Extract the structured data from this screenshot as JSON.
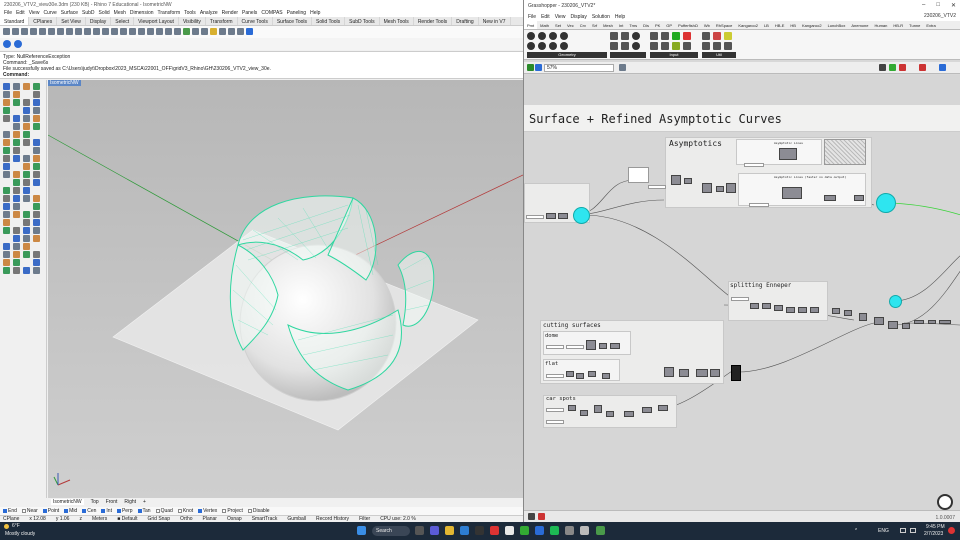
{
  "rhino": {
    "title": "230206_VTV2_view30e.3dm (230 KB) - Rhino 7 Educational - IsometricNW",
    "menu": [
      "File",
      "Edit",
      "View",
      "Curve",
      "Surface",
      "SubD",
      "Solid",
      "Mesh",
      "Dimension",
      "Transform",
      "Tools",
      "Analyze",
      "Render",
      "Panels",
      "COMPAS",
      "Paneling",
      "Help"
    ],
    "tabs": [
      "Standard",
      "CPlanes",
      "Set View",
      "Display",
      "Select",
      "Viewport Layout",
      "Visibility",
      "Transform",
      "Curve Tools",
      "Surface Tools",
      "Solid Tools",
      "SubD Tools",
      "Mesh Tools",
      "Render Tools",
      "Drafting",
      "New in V7"
    ],
    "active_tab": "Standard",
    "command_lines": [
      "Type: NullReferenceException",
      "Command: _Save6s",
      "File successfully saved as C:\\Users\\judyt\\Dropbox\\2023_MSCA\\22001_OFF\\gridV3_Rhino\\GH\\230206_VTV2_view_30e.",
      "Command:"
    ],
    "viewport_label": "IsometricNW",
    "viewport_tabs": [
      "IsometricNW",
      "Top",
      "Front",
      "Right",
      "+"
    ],
    "osnaps": [
      {
        "label": "End",
        "on": true
      },
      {
        "label": "Near",
        "on": false
      },
      {
        "label": "Point",
        "on": true
      },
      {
        "label": "Mid",
        "on": true
      },
      {
        "label": "Cen",
        "on": true
      },
      {
        "label": "Int",
        "on": true
      },
      {
        "label": "Perp",
        "on": true
      },
      {
        "label": "Tan",
        "on": true
      },
      {
        "label": "Quad",
        "on": false
      },
      {
        "label": "Knot",
        "on": false
      },
      {
        "label": "Vertex",
        "on": true
      },
      {
        "label": "Project",
        "on": false
      },
      {
        "label": "Disable",
        "on": false
      }
    ],
    "status": [
      "CPlane",
      "x 12.08",
      "y 1.06",
      "z",
      "Meters",
      "■ Default",
      "Grid Snap",
      "Ortho",
      "Planar",
      "Osnap",
      "SmartTrack",
      "Gumball",
      "Record History",
      "Filter",
      "CPU use: 2.0 %"
    ]
  },
  "gh": {
    "title": "Grasshopper - 230206_VTV2*",
    "file": "230206_VTV2",
    "menu": [
      "File",
      "Edit",
      "View",
      "Display",
      "Solution",
      "Help"
    ],
    "tabs": [
      "Pmt",
      "Math",
      "Set",
      "Vec",
      "Crv",
      "Srf",
      "Mesh",
      "Int",
      "Trns",
      "Dis",
      "PK",
      "GP",
      "PufferfishΩ",
      "Wb",
      "RhSpace",
      "Kangaroo2",
      "LB",
      "HB-E",
      "HB",
      "Kangaroo2",
      "LunchBox",
      "Anemone",
      "Human",
      "HB-R",
      "Tunne",
      "Extra"
    ],
    "active_tab": "Pmt",
    "ribbon_groups": [
      "Geometry",
      "Input",
      "Util"
    ],
    "zoom": "57%",
    "main_title": "Surface + Refined Asymptotic Curves",
    "groups": {
      "asymptotics": "Asymptotics",
      "asym_lines": "Asymptotic Lines",
      "asym_lines_faster": "Asymptotic Lines (faster no data output)",
      "splitting": "splitting Enneper",
      "cutting": "cutting surfaces",
      "dome": "dome",
      "flat": "flat",
      "car_spots": "car spots"
    },
    "version": "1.0.0007"
  },
  "taskbar": {
    "weather_temp": "6°F",
    "weather_desc": "Mostly cloudy",
    "search": "Search",
    "lang": "ENG",
    "time": "9:45 PM",
    "date": "2/7/2023"
  }
}
